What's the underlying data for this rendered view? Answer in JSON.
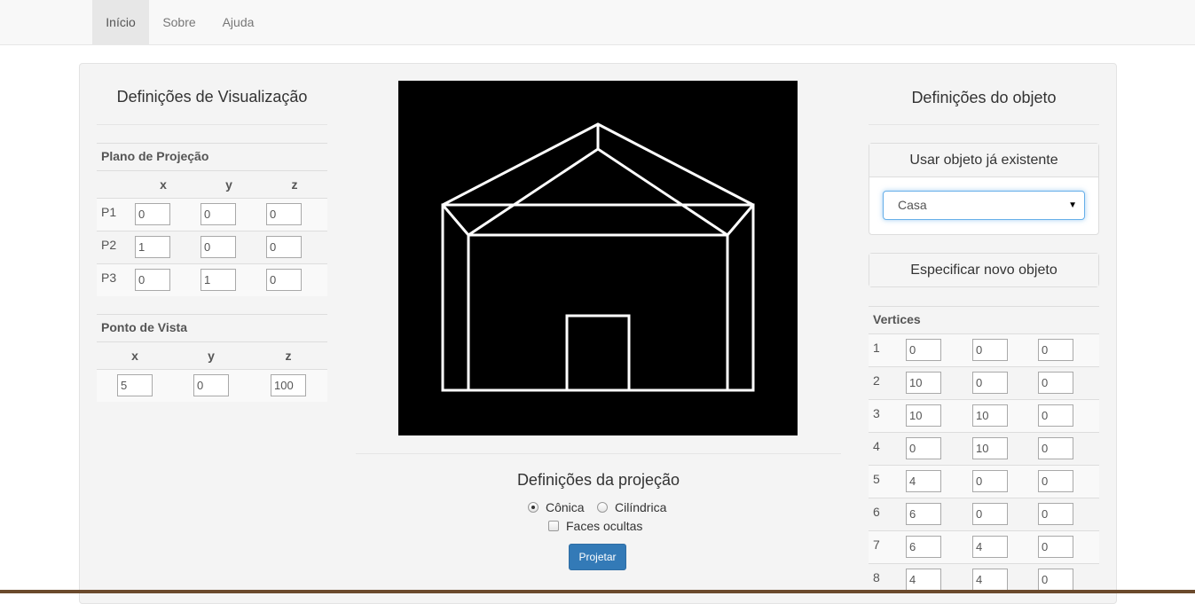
{
  "nav": {
    "items": [
      {
        "label": "Início",
        "active": true
      },
      {
        "label": "Sobre",
        "active": false
      },
      {
        "label": "Ajuda",
        "active": false
      }
    ]
  },
  "left": {
    "title": "Definições de Visualização",
    "plano": {
      "title": "Plano de Projeção",
      "cols": [
        "x",
        "y",
        "z"
      ],
      "rows": [
        {
          "label": "P1",
          "values": [
            "0",
            "0",
            "0"
          ]
        },
        {
          "label": "P2",
          "values": [
            "1",
            "0",
            "0"
          ]
        },
        {
          "label": "P3",
          "values": [
            "0",
            "1",
            "0"
          ]
        }
      ]
    },
    "ponto": {
      "title": "Ponto de Vista",
      "cols": [
        "x",
        "y",
        "z"
      ],
      "values": [
        "5",
        "0",
        "100"
      ]
    }
  },
  "center": {
    "title": "Definições da projeção",
    "options": [
      {
        "label": "Cônica",
        "checked": true
      },
      {
        "label": "Cilíndrica",
        "checked": false
      }
    ],
    "hidden_faces_label": "Faces ocultas",
    "button_label": "Projetar"
  },
  "right": {
    "title": "Definições do objeto",
    "existing_title": "Usar objeto já existente",
    "selected_object": "Casa",
    "new_object_label": "Especificar novo objeto",
    "vertices_title": "Vertices",
    "vertices": [
      {
        "label": "1",
        "values": [
          "0",
          "0",
          "0"
        ]
      },
      {
        "label": "2",
        "values": [
          "10",
          "0",
          "0"
        ]
      },
      {
        "label": "3",
        "values": [
          "10",
          "10",
          "0"
        ]
      },
      {
        "label": "4",
        "values": [
          "0",
          "10",
          "0"
        ]
      },
      {
        "label": "5",
        "values": [
          "4",
          "0",
          "0"
        ]
      },
      {
        "label": "6",
        "values": [
          "6",
          "0",
          "0"
        ]
      },
      {
        "label": "7",
        "values": [
          "6",
          "4",
          "0"
        ]
      },
      {
        "label": "8",
        "values": [
          "4",
          "4",
          "0"
        ]
      }
    ]
  },
  "colors": {
    "primary": "#337ab7",
    "canvas_bg": "#000000",
    "drawing": "#ffffff"
  }
}
